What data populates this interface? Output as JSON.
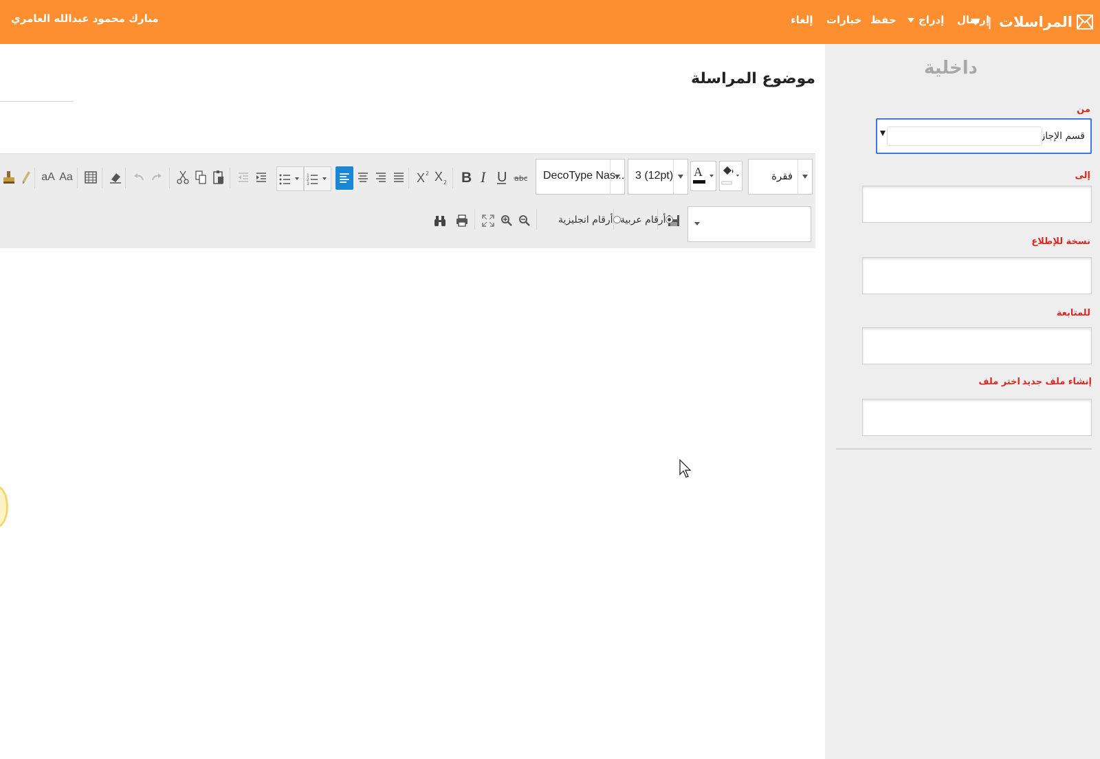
{
  "topbar": {
    "app_title": "المراسلات",
    "separator": "|",
    "user_name": "مبارك محمود عبدالله العامري",
    "menu": {
      "send": "إرسال",
      "insert": "إدراج",
      "save": "حفظ",
      "options": "خيارات",
      "cancel": "إلغاء"
    },
    "bg_color": "#fd8f30"
  },
  "sidebar": {
    "section_title": "داخلية",
    "from_label": "من",
    "from_value": "قسم الإجازات",
    "to_label": "إلى",
    "cc_label": "نسخة للإطلاع",
    "followup_label": "للمتابعة",
    "create_file": "إنشاء ملف جديد",
    "choose_file": "اختر ملف",
    "label_color": "#e0261f"
  },
  "subject": {
    "label": "موضوع المراسلة"
  },
  "toolbar": {
    "paragraph": "فقرة",
    "font_size": "3 (12pt)",
    "font_name": "DecoType Nas...",
    "arabic_numbers": "أرقام عربية",
    "english_numbers": "أرقام انجليزية",
    "arabic_numbers_selected": true,
    "english_numbers_selected": false,
    "upper_case": "aA",
    "title_case": "Aa",
    "active_align": "align-left",
    "active_color": "#1a87d6"
  }
}
